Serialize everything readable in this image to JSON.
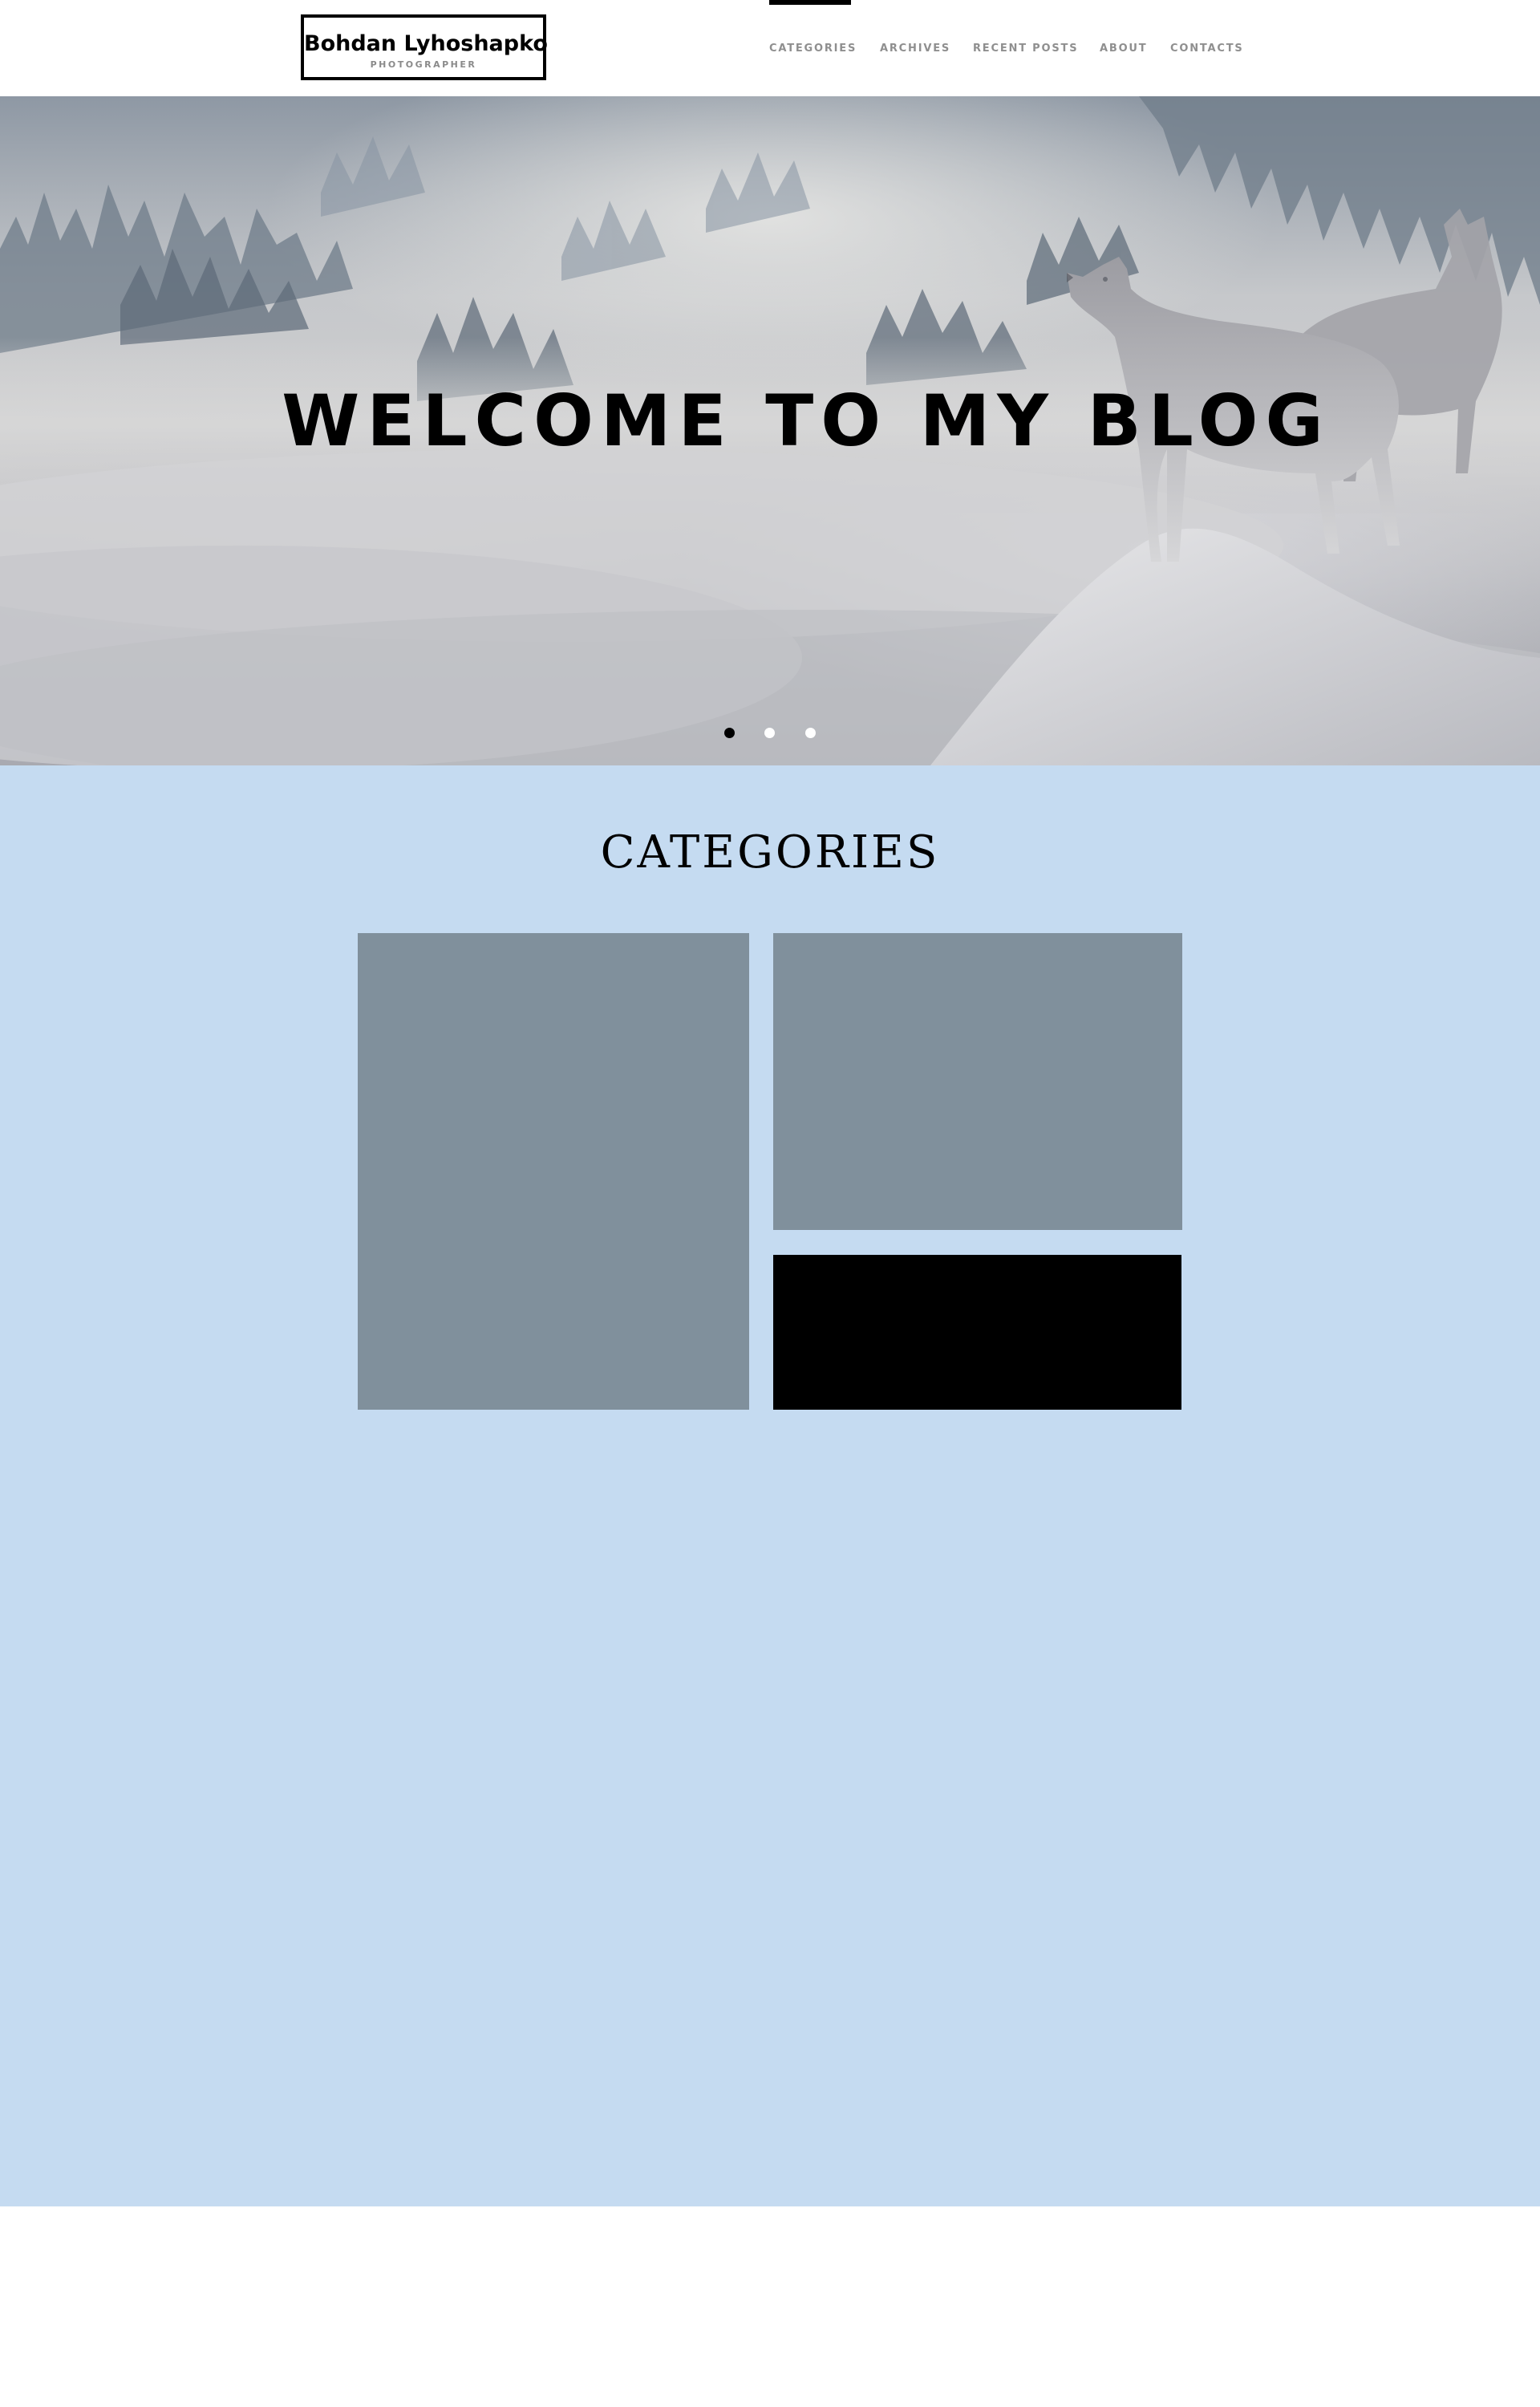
{
  "header": {
    "logo": {
      "name": "Bohdan Lyhoshapko",
      "subtitle": "PHOTOGRAPHER"
    },
    "nav": [
      {
        "label": "CATEGORIES",
        "active": true
      },
      {
        "label": "ARCHIVES",
        "active": false
      },
      {
        "label": "RECENT POSTS",
        "active": false
      },
      {
        "label": "ABOUT",
        "active": false
      },
      {
        "label": "CONTACTS",
        "active": false
      }
    ]
  },
  "hero": {
    "title": "WELCOME TO MY BLOG",
    "slides": {
      "count": 3,
      "active_index": 0
    },
    "dot_colors": {
      "active": "#000000",
      "inactive": "#ffffff"
    }
  },
  "categories": {
    "title": "CATEGORIES",
    "background": "#c5dbf1",
    "tiles": [
      {
        "color": "#80909c"
      },
      {
        "color": "#80909c"
      },
      {
        "color": "#000000"
      }
    ]
  }
}
